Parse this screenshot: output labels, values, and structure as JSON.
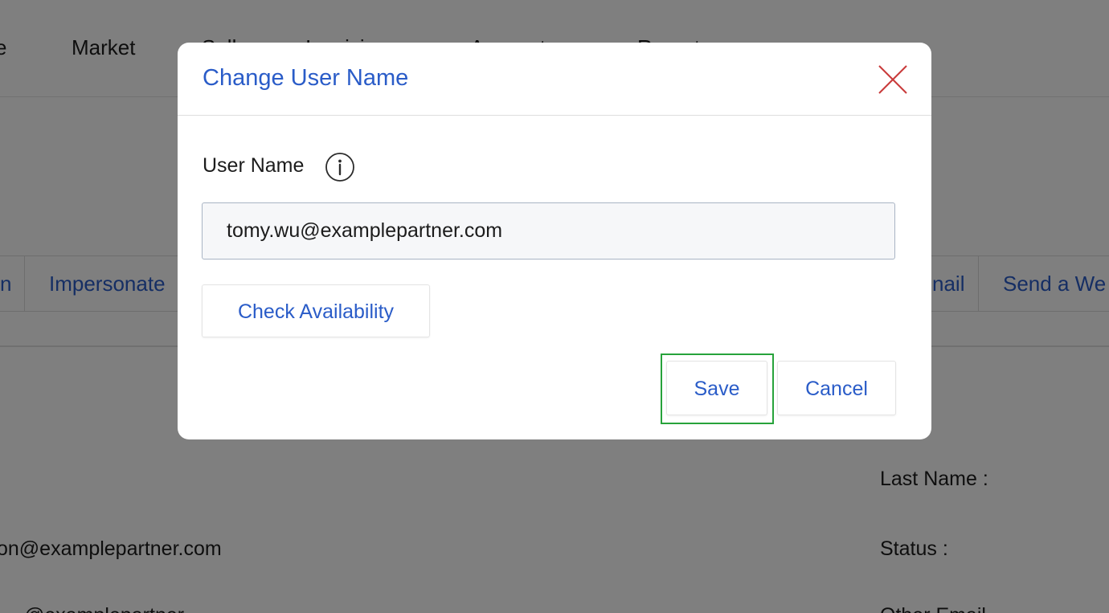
{
  "background": {
    "nav": [
      "e",
      "Market",
      "Sell",
      "Invoicing",
      "Accounts",
      "Reports"
    ],
    "actions": [
      "n",
      "Impersonate",
      "nail",
      "Send a We"
    ],
    "fields": {
      "email_partial": "on@examplepartner.com",
      "email_partial_2": "@examplepartner",
      "last_name_label": "Last Name :",
      "status_label": "Status :",
      "other_email_label": "Other Email"
    }
  },
  "modal": {
    "title": "Change User Name",
    "field_label": "User Name",
    "input_value": "tomy.wu@examplepartner.com",
    "check_availability": "Check Availability",
    "save": "Save",
    "cancel": "Cancel"
  },
  "colors": {
    "accent": "#2a5cc8",
    "close": "#c93a3a",
    "highlight": "#27a33b",
    "overlay": "rgba(0,0,0,0.5)"
  },
  "icons": {
    "close": "close-icon",
    "info": "info-icon"
  }
}
